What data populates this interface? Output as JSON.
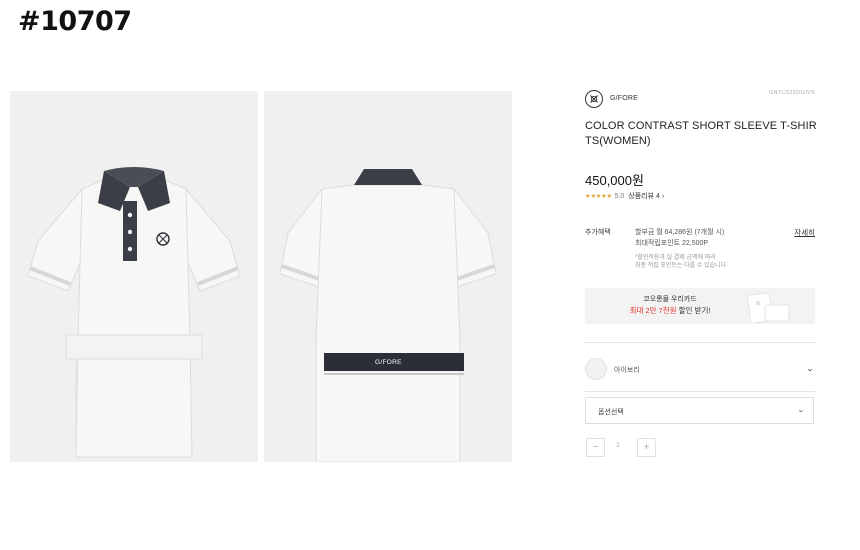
{
  "listing_id": "#10707",
  "product": {
    "brand_name": "G/FORE",
    "brand_logo_icon": "gfore-logo-icon",
    "product_code": "GNTCS23201IVX",
    "title": "COLOR CONTRAST SHORT SLEEVE T-SHIRTS(WOMEN)",
    "price": "450,000원",
    "rating": {
      "stars": "★★★★★",
      "score": "5.0",
      "review_link": "상품리뷰 4 ›"
    }
  },
  "images": {
    "front_logo_text": "",
    "back_band_text": "G/FORE"
  },
  "benefits": {
    "label": "추가혜택",
    "line1": "할부금 월 64,286원 (7개월 시)",
    "line2": "최대적립포인트 22,500P",
    "note1": "*할인적용과 실 결제 금액에 따라",
    "note2": "최종 적립 포인트는 다를 수 있습니다",
    "detail_link": "자세히"
  },
  "card_banner": {
    "line1": "코오롱몰 우리카드",
    "line2_highlight": "최대 2만 7천원",
    "line2_rest": " 할인 받기!"
  },
  "color_option": {
    "name": "아이보리",
    "swatch_color": "#f1f1ef"
  },
  "option_select": {
    "label": "옵션선택"
  },
  "quantity": {
    "minus": "−",
    "value": "1",
    "plus": "+"
  },
  "colors": {
    "collar_navy": "#3b3e47",
    "shirt_ivory": "#f7f7f5",
    "image_bg": "#f0f0f0",
    "highlight_red": "#e4332c"
  }
}
